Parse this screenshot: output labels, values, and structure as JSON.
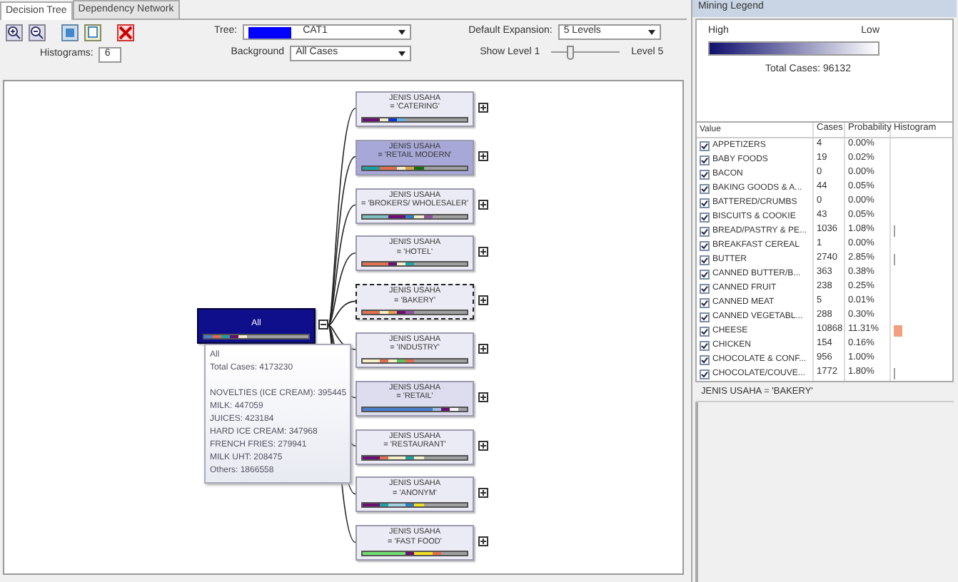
{
  "tabs": [
    {
      "label": "Decision Tree",
      "selected": true
    },
    {
      "label": "Dependency Network",
      "selected": false
    }
  ],
  "toolbar": {
    "tree_label": "Tree:",
    "tree_value": "CAT1",
    "expansion_label": "Default Expansion:",
    "expansion_value": "5 Levels",
    "histograms_label": "Histograms:",
    "histograms_value": "6",
    "background_label": "Background",
    "background_value": "All Cases",
    "show_level_label": "Show Level 1",
    "level_end_label": "Level 5",
    "show_level": {
      "level": 0.25
    }
  },
  "tree": {
    "root": {
      "label": "All",
      "color": "#0f0f8c",
      "expanded": true,
      "segments": [
        {
          "color": "#4a7fd0"
        },
        {
          "color": "#e06a50"
        },
        {
          "color": "#20a0a0"
        },
        {
          "color": "#6a1070"
        },
        {
          "color": "#f5f0c8"
        },
        {
          "color": "#a0a0a0"
        },
        {
          "color": "#a0a0a0"
        },
        {
          "color": "#a0a0a0"
        },
        {
          "color": "#a0a0a0"
        },
        {
          "color": "#a0a0a0"
        },
        {
          "color": "#a0a0a0"
        },
        {
          "color": "#a0a0a0"
        }
      ]
    },
    "children": [
      {
        "line1": "JENIS USAHA",
        "line2": "= 'CATERING'",
        "color": "#ebebf5",
        "selected": false,
        "expanded": false,
        "segments": [
          {
            "color": "#6a1070"
          },
          {
            "color": "#6a1070"
          },
          {
            "color": "#f5f0c8"
          },
          {
            "color": "#1030d0"
          },
          {
            "color": "#6ab0e0"
          },
          {
            "color": "#a0a0a0"
          },
          {
            "color": "#a0a0a0"
          },
          {
            "color": "#a0a0a0"
          },
          {
            "color": "#a0a0a0"
          },
          {
            "color": "#a0a0a0"
          },
          {
            "color": "#a0a0a0"
          },
          {
            "color": "#a0a0a0"
          }
        ]
      },
      {
        "line1": "JENIS USAHA",
        "line2": "= 'RETAIL MODERN'",
        "color": "#a8a8d8",
        "selected": false,
        "expanded": false,
        "segments": [
          {
            "color": "#20a0a0"
          },
          {
            "color": "#20a0a0"
          },
          {
            "color": "#e07050"
          },
          {
            "color": "#e07050"
          },
          {
            "color": "#f5f0c8"
          },
          {
            "color": "#e0a050"
          },
          {
            "color": "#107010"
          },
          {
            "color": "#a0a0a0"
          },
          {
            "color": "#a0a0a0"
          },
          {
            "color": "#a0a0a0"
          },
          {
            "color": "#a0a0a0"
          },
          {
            "color": "#a0a0a0"
          }
        ]
      },
      {
        "line1": "JENIS USAHA",
        "line2": "= 'BROKERS/ WHOLESALER'",
        "color": "#ebebf5",
        "selected": false,
        "expanded": false,
        "segments": [
          {
            "color": "#80c0c0"
          },
          {
            "color": "#80c0c0"
          },
          {
            "color": "#80c0c0"
          },
          {
            "color": "#6a1070"
          },
          {
            "color": "#6a1070"
          },
          {
            "color": "#3080c0"
          },
          {
            "color": "#f5f0c8"
          },
          {
            "color": "#9050a0"
          },
          {
            "color": "#a0a0a0"
          },
          {
            "color": "#a0a0a0"
          },
          {
            "color": "#a0a0a0"
          },
          {
            "color": "#a0a0a0"
          }
        ]
      },
      {
        "line1": "JENIS USAHA",
        "line2": "= 'HOTEL'",
        "color": "#ebebf5",
        "selected": false,
        "expanded": false,
        "segments": [
          {
            "color": "#e07050"
          },
          {
            "color": "#e07050"
          },
          {
            "color": "#e07050"
          },
          {
            "color": "#6a1070"
          },
          {
            "color": "#f5f0c8"
          },
          {
            "color": "#20a0a0"
          },
          {
            "color": "#a0a0a0"
          },
          {
            "color": "#a0a0a0"
          },
          {
            "color": "#a0a0a0"
          },
          {
            "color": "#a0a0a0"
          },
          {
            "color": "#a0a0a0"
          },
          {
            "color": "#a0a0a0"
          }
        ]
      },
      {
        "line1": "JENIS USAHA",
        "line2": "= 'BAKERY'",
        "color": "#ebebf5",
        "selected": true,
        "expanded": false,
        "segments": [
          {
            "color": "#e07050"
          },
          {
            "color": "#e07050"
          },
          {
            "color": "#f5f0c8"
          },
          {
            "color": "#e0a050"
          },
          {
            "color": "#6a1070"
          },
          {
            "color": "#9050a0"
          },
          {
            "color": "#a0a0a0"
          },
          {
            "color": "#a0a0a0"
          },
          {
            "color": "#a0a0a0"
          },
          {
            "color": "#a0a0a0"
          },
          {
            "color": "#a0a0a0"
          },
          {
            "color": "#a0a0a0"
          }
        ]
      },
      {
        "line1": "JENIS USAHA",
        "line2": "= 'INDUSTRY'",
        "color": "#ebebf5",
        "selected": false,
        "expanded": false,
        "segments": [
          {
            "color": "#f5f0c8"
          },
          {
            "color": "#f5f0c8"
          },
          {
            "color": "#e07050"
          },
          {
            "color": "#f5f0c8"
          },
          {
            "color": "#60c060"
          },
          {
            "color": "#e07050"
          },
          {
            "color": "#a0a0a0"
          },
          {
            "color": "#a0a0a0"
          },
          {
            "color": "#a0a0a0"
          },
          {
            "color": "#a0a0a0"
          },
          {
            "color": "#a0a0a0"
          },
          {
            "color": "#a0a0a0"
          }
        ]
      },
      {
        "line1": "JENIS USAHA",
        "line2": "= 'RETAIL'",
        "color": "#ddddef",
        "selected": false,
        "expanded": false,
        "segments": [
          {
            "color": "#4a7fd0"
          },
          {
            "color": "#4a7fd0"
          },
          {
            "color": "#4a7fd0"
          },
          {
            "color": "#4a7fd0"
          },
          {
            "color": "#4a7fd0"
          },
          {
            "color": "#4a7fd0"
          },
          {
            "color": "#4a7fd0"
          },
          {
            "color": "#4a7fd0"
          },
          {
            "color": "#a0c0e0"
          },
          {
            "color": "#6a1070"
          },
          {
            "color": "#ffffff"
          },
          {
            "color": "#a0a0a0"
          }
        ]
      },
      {
        "line1": "JENIS USAHA",
        "line2": "= 'RESTAURANT'",
        "color": "#ebebf5",
        "selected": false,
        "expanded": false,
        "segments": [
          {
            "color": "#6a1070"
          },
          {
            "color": "#6a1070"
          },
          {
            "color": "#e07050"
          },
          {
            "color": "#f5f0c8"
          },
          {
            "color": "#f5f0c8"
          },
          {
            "color": "#20a0a0"
          },
          {
            "color": "#f5f0c8"
          },
          {
            "color": "#a0a0a0"
          },
          {
            "color": "#a0a0a0"
          },
          {
            "color": "#a0a0a0"
          },
          {
            "color": "#a0a0a0"
          },
          {
            "color": "#a0a0a0"
          }
        ]
      },
      {
        "line1": "JENIS USAHA",
        "line2": "= 'ANONYM'",
        "color": "#ebebf5",
        "selected": false,
        "expanded": false,
        "segments": [
          {
            "color": "#6a1070"
          },
          {
            "color": "#6a1070"
          },
          {
            "color": "#20a0a0"
          },
          {
            "color": "#a0d0e0"
          },
          {
            "color": "#a0d0e0"
          },
          {
            "color": "#3080c0"
          },
          {
            "color": "#f0e020"
          },
          {
            "color": "#a0a0a0"
          },
          {
            "color": "#a0a0a0"
          },
          {
            "color": "#a0a0a0"
          },
          {
            "color": "#a0a0a0"
          },
          {
            "color": "#a0a0a0"
          }
        ]
      },
      {
        "line1": "JENIS USAHA",
        "line2": "= 'FAST FOOD'",
        "color": "#ebebf5",
        "selected": false,
        "expanded": false,
        "segments": [
          {
            "color": "#70e070"
          },
          {
            "color": "#70e070"
          },
          {
            "color": "#70e070"
          },
          {
            "color": "#70e070"
          },
          {
            "color": "#70e070"
          },
          {
            "color": "#6a1070"
          },
          {
            "color": "#f0e020"
          },
          {
            "color": "#f0e020"
          },
          {
            "color": "#e07050"
          },
          {
            "color": "#a0a0a0"
          },
          {
            "color": "#a0a0a0"
          },
          {
            "color": "#a0a0a0"
          }
        ]
      }
    ]
  },
  "tooltip": {
    "title": "All",
    "total": "Total Cases: 4173230",
    "lines": [
      "NOVELTIES (ICE CREAM): 395445",
      "MILK: 447059",
      "JUICES: 423184",
      "HARD ICE CREAM: 347968",
      "FRENCH FRIES: 279941",
      "MILK UHT: 208475",
      "Others: 1866558"
    ]
  },
  "legend": {
    "title": "Mining Legend",
    "high": "High",
    "low": "Low",
    "total_cases": "Total Cases: 96132",
    "columns": [
      "Value",
      "Cases",
      "Probability",
      "Histogram"
    ],
    "rows": [
      {
        "value": "APPETIZERS",
        "cases": "4",
        "probability": "0.00%",
        "checked": true
      },
      {
        "value": "BABY FOODS",
        "cases": "19",
        "probability": "0.02%",
        "checked": true
      },
      {
        "value": "BACON",
        "cases": "0",
        "probability": "0.00%",
        "checked": true
      },
      {
        "value": "BAKING GOODS & A...",
        "cases": "44",
        "probability": "0.05%",
        "checked": true
      },
      {
        "value": "BATTERED/CRUMBS",
        "cases": "0",
        "probability": "0.00%",
        "checked": true
      },
      {
        "value": "BISCUITS & COOKIE",
        "cases": "43",
        "probability": "0.05%",
        "checked": true
      },
      {
        "value": "BREAD/PASTRY & PE...",
        "cases": "1036",
        "probability": "1.08%",
        "checked": true,
        "histogram": {
          "kind": "tick",
          "color": "#a0a0a0"
        }
      },
      {
        "value": "BREAKFAST CEREAL",
        "cases": "1",
        "probability": "0.00%",
        "checked": true
      },
      {
        "value": "BUTTER",
        "cases": "2740",
        "probability": "2.85%",
        "checked": true,
        "histogram": {
          "kind": "tick",
          "color": "#a0a0a0"
        }
      },
      {
        "value": "CANNED BUTTER/B...",
        "cases": "363",
        "probability": "0.38%",
        "checked": true
      },
      {
        "value": "CANNED FRUIT",
        "cases": "238",
        "probability": "0.25%",
        "checked": true
      },
      {
        "value": "CANNED MEAT",
        "cases": "5",
        "probability": "0.01%",
        "checked": true
      },
      {
        "value": "CANNED VEGETABL...",
        "cases": "288",
        "probability": "0.30%",
        "checked": true
      },
      {
        "value": "CHEESE",
        "cases": "10868",
        "probability": "11.31%",
        "checked": true,
        "histogram": {
          "kind": "block",
          "color": "#f0a080"
        }
      },
      {
        "value": "CHICKEN",
        "cases": "154",
        "probability": "0.16%",
        "checked": true
      },
      {
        "value": "CHOCOLATE & CONF...",
        "cases": "956",
        "probability": "1.00%",
        "checked": true
      },
      {
        "value": "CHOCOLATE/COUVE...",
        "cases": "1772",
        "probability": "1.80%",
        "checked": true,
        "histogram": {
          "kind": "tick",
          "color": "#a0a0a0"
        }
      }
    ],
    "selection": "JENIS USAHA = 'BAKERY'"
  }
}
